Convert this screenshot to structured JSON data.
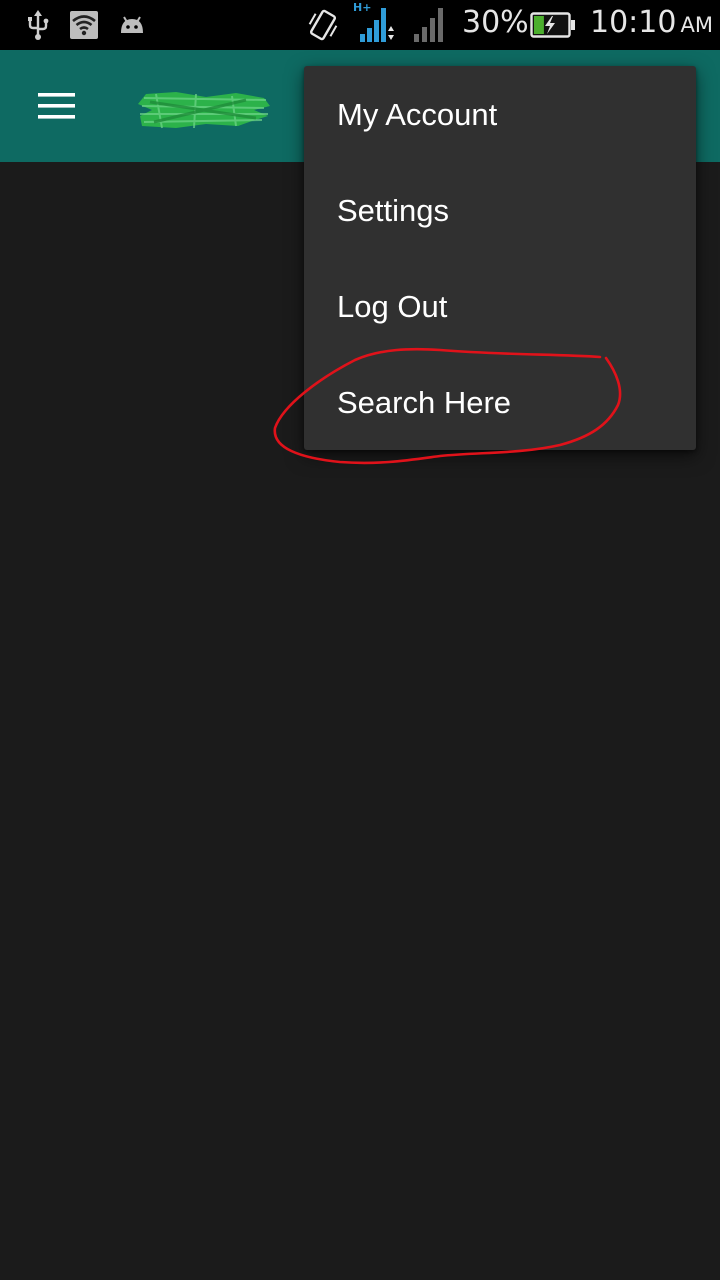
{
  "status_bar": {
    "battery_percent": "30%",
    "time": "10:10",
    "ampm": "AM",
    "network_type": "H+",
    "icons": [
      "usb-icon",
      "wifi-icon",
      "android-icon",
      "vibrate-icon",
      "signal-icon",
      "signal-icon",
      "battery-charging-icon"
    ],
    "battery_level": 0.3
  },
  "app_bar": {
    "background_color": "#0e6a62",
    "menu_icon": "hamburger-menu-icon",
    "logo": "app-logo (scribbled out)"
  },
  "overflow_menu": {
    "items": [
      {
        "label": "My Account"
      },
      {
        "label": "Settings"
      },
      {
        "label": "Log Out"
      },
      {
        "label": "Search Here"
      }
    ],
    "background_color": "#303030"
  },
  "annotation": {
    "color": "#e0121a",
    "target_item": "Search Here"
  }
}
